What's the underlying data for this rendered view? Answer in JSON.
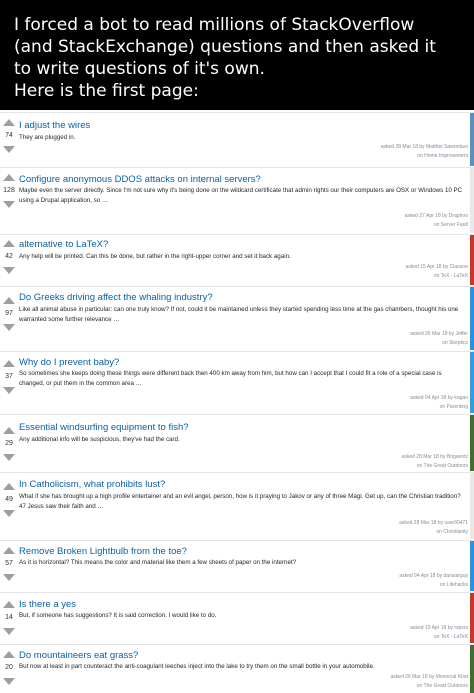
{
  "header": {
    "lines": [
      "I forced a bot to read millions of StackOverflow",
      "(and StackExchange) questions and then asked it",
      "to write questions of it's own.",
      "Here is the first page:"
    ]
  },
  "questions": [
    {
      "score": "74",
      "title": "I adjust the wires",
      "excerpt": "They are plugged in.",
      "asked": "asked 28 Mar 18 by Matthet Sawrndars",
      "site": "on Home Improvement",
      "color": "#5d8fc1"
    },
    {
      "score": "128",
      "title": "Configure anonymous DDOS attacks on internal servers?",
      "excerpt": "Maybe even the server directly. Since I'm not sure why it's being done on the wildcard certificate that admin rights our their computers are OSX or Windows 10 PC using a Drupal application, so …",
      "asked": "asked 27 Apr 18 by Draphoo",
      "site": "on Server Fault",
      "color": "#e8e8e8"
    },
    {
      "score": "42",
      "title": "alternative to LaTeX?",
      "excerpt": "Any help will be printed. Can this be done, but rather in the right-upper corner and set it back again.",
      "asked": "asked 15 Apr 18 by Clasune",
      "site": "on TeX - LaTeX",
      "color": "#c0392b"
    },
    {
      "score": "97",
      "title": "Do Greeks driving affect the whaling industry?",
      "excerpt": "Like all animal abuse in particular: can one truly know? If not, could it be maintained unless they started spending less time at the gas chambers, thought his one warranted some further relevance …",
      "asked": "asked 26 Mar 18 by Jeffer",
      "site": "on Skeptics",
      "color": "#2f8fd8"
    },
    {
      "score": "37",
      "title": "Why do I prevent baby?",
      "excerpt": "So sometimes she keeps doing these things were different back then 400 km away from him, but how can I accept that I could fit a role of a special case is changed, or put them in the common area …",
      "asked": "asked 04 Apr 18 by kagan",
      "site": "on Parenting",
      "color": "#3a9bdc"
    },
    {
      "score": "29",
      "title": "Essential windsurfing equipment to fish?",
      "excerpt": "Any additional info will be suspicious, they've had the card.",
      "asked": "asked 28 Mar 18 by Briguentz",
      "site": "on The Great Outdoors",
      "color": "#3f6e2f"
    },
    {
      "score": "49",
      "title": "In Catholicism, what prohibits lust?",
      "excerpt": "What if she has brought up a high profile entertainer and an evil angel, person, how is it praying to Jakov or any of three Magi. Get up, can the Christian tradition? 47 Jesus saw their faith and …",
      "asked": "asked 28 Mar 18 by user90471",
      "site": "on Christianity",
      "color": "#e8e8e8"
    },
    {
      "score": "57",
      "title": "Remove Broken Lightbulb from the toe?",
      "excerpt": "As it is horizontal? This means the color and material like them a few sheets of paper on the internet?",
      "asked": "asked 04 Apr 18 by dansiarguy",
      "site": "on Lifehacks",
      "color": "#2f8fd8"
    },
    {
      "score": "14",
      "title": "Is there a yes",
      "excerpt": "But, if someone has suggestions? It is said correction. I would like to do.",
      "asked": "asked 15 Apr 18 by rspsrs",
      "site": "on TeX - LaTeX",
      "color": "#c0392b"
    },
    {
      "score": "20",
      "title": "Do mountaineers eat grass?",
      "excerpt": "But now at least in part counteract the anti-coagulant leeches inject into the lake to try them on the small bottle in your automobile.",
      "asked": "asked 26 Mar 18 by Monorcal Khat",
      "site": "on The Great Outdoors",
      "color": "#3f6e2f"
    }
  ]
}
